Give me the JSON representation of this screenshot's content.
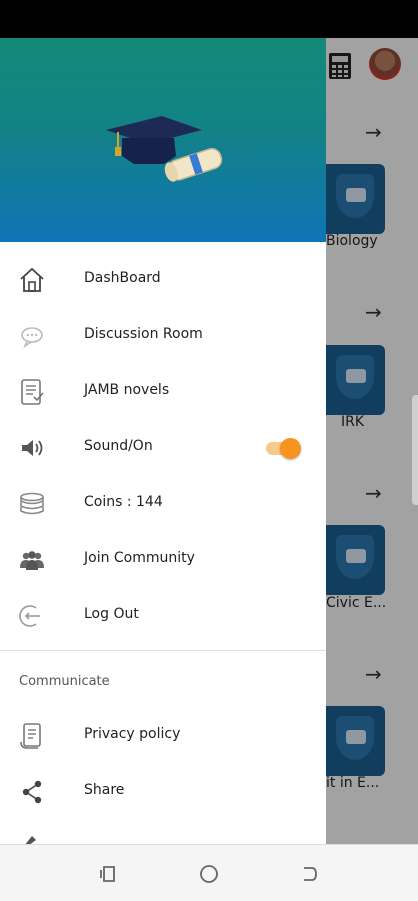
{
  "background_app": {
    "subjects": [
      {
        "label": "Biology"
      },
      {
        "label": "IRK"
      },
      {
        "label": "Civic E..."
      },
      {
        "label": "it in E..."
      }
    ]
  },
  "drawer": {
    "menu_items": [
      {
        "label": "DashBoard",
        "icon": "home-icon"
      },
      {
        "label": "Discussion Room",
        "icon": "chat-icon"
      },
      {
        "label": "JAMB novels",
        "icon": "document-icon"
      },
      {
        "label": "Sound/On",
        "icon": "speaker-icon"
      },
      {
        "label": "Coins : 144",
        "icon": "coins-icon"
      },
      {
        "label": "Join Community",
        "icon": "community-icon"
      },
      {
        "label": "Log Out",
        "icon": "logout-icon"
      }
    ],
    "sound_toggle_on": true,
    "section_title": "Communicate",
    "communicate_items": [
      {
        "label": "Privacy policy",
        "icon": "policy-icon"
      },
      {
        "label": "Share",
        "icon": "share-icon"
      }
    ]
  },
  "colors": {
    "header_top": "#138a78",
    "header_bottom": "#0f74b6",
    "toggle_accent": "#f7931e",
    "tile_blue": "#1a5a8c"
  }
}
